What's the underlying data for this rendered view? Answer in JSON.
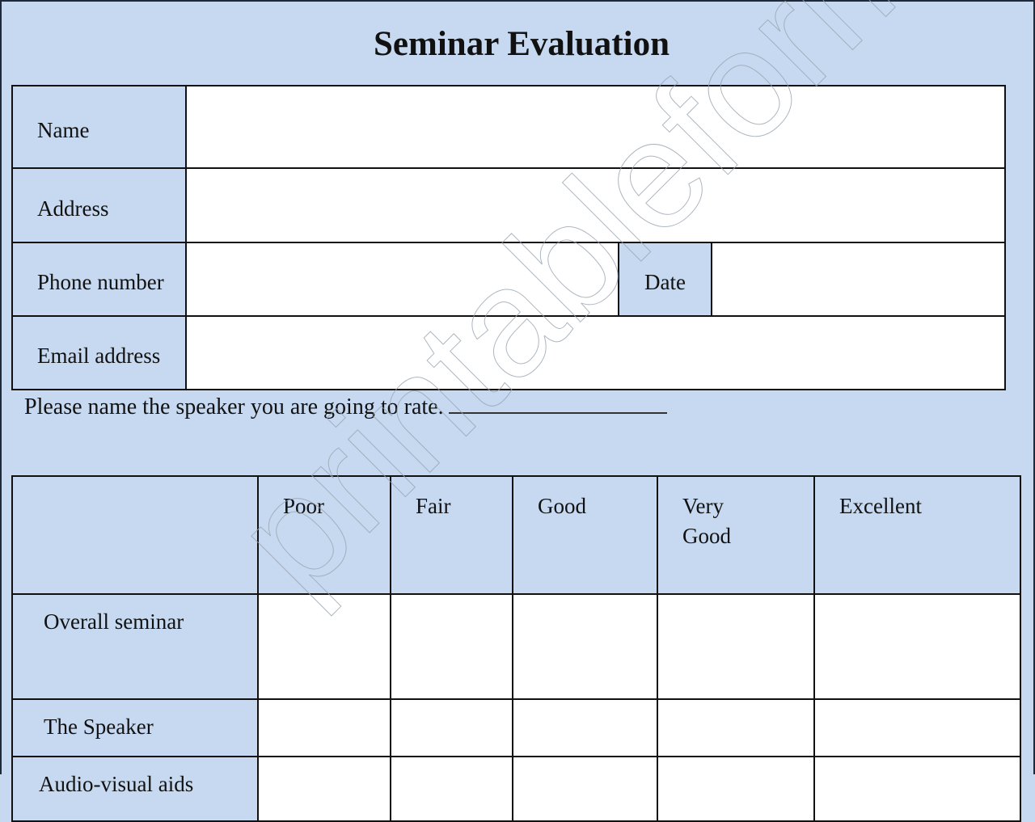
{
  "title": "Seminar Evaluation",
  "info_fields": {
    "name": {
      "label": "Name",
      "value": ""
    },
    "address": {
      "label": "Address",
      "value": ""
    },
    "phone": {
      "label": "Phone number",
      "value": ""
    },
    "date": {
      "label": "Date",
      "value": ""
    },
    "email": {
      "label": "Email address",
      "value": ""
    }
  },
  "speaker_prompt": "Please name the speaker you are going to rate.",
  "ratings": {
    "columns": [
      "Poor",
      "Fair",
      "Good",
      "Very Good",
      "Excellent"
    ],
    "rows": [
      "Overall seminar",
      "The Speaker",
      "Audio-visual aids"
    ]
  },
  "watermark": "printableforms.com",
  "colors": {
    "label_bg": "#c6d9f0",
    "input_bg": "#ffffff",
    "border": "#111111"
  }
}
